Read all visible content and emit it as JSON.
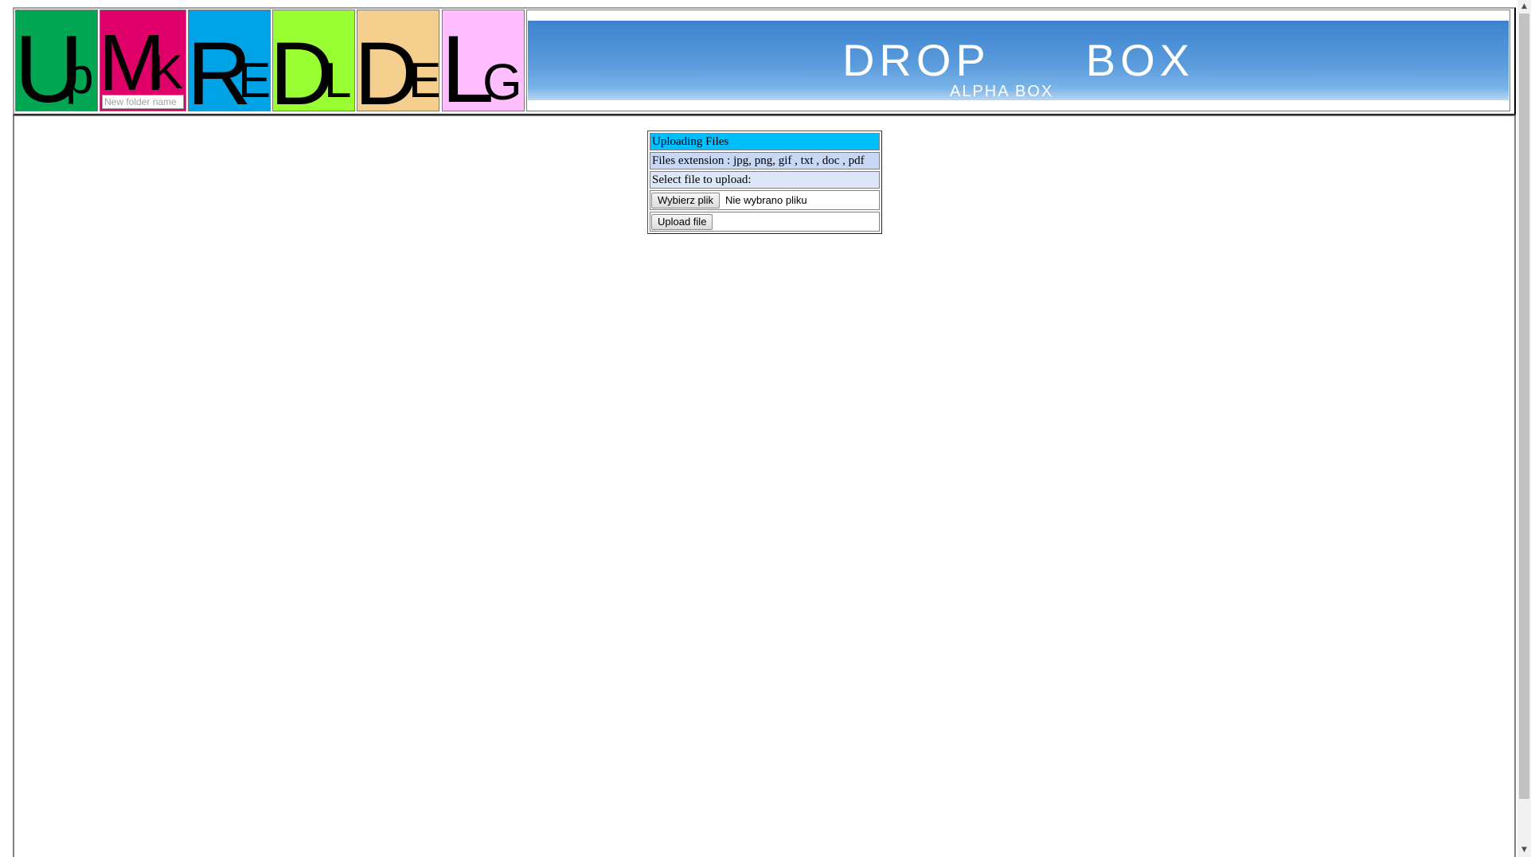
{
  "tiles": [
    {
      "id": "up",
      "big": "U",
      "small": "p",
      "color": "#00a651"
    },
    {
      "id": "mk",
      "big": "M",
      "small": "K",
      "color": "#e0006a",
      "input_placeholder": "New folder name"
    },
    {
      "id": "re",
      "big": "R",
      "small": "E",
      "color": "#00a3e6"
    },
    {
      "id": "dl",
      "big": "D",
      "small": "L",
      "color": "#99ff33"
    },
    {
      "id": "de",
      "big": "D",
      "small": "E",
      "color": "#f4cf8d"
    },
    {
      "id": "lg",
      "big": "L",
      "small": "G",
      "color": "#ffbfff"
    }
  ],
  "banner": {
    "title_left": "DROP",
    "title_right": "BOX",
    "subtitle": "ALPHA BOX"
  },
  "upload": {
    "title": "Uploading Files",
    "extensions": "Files extension : jpg, png, gif , txt , doc , pdf",
    "select_label": "Select file to upload:",
    "choose_button": "Wybierz plik",
    "file_status": "Nie wybrano pliku",
    "upload_button": "Upload file"
  }
}
